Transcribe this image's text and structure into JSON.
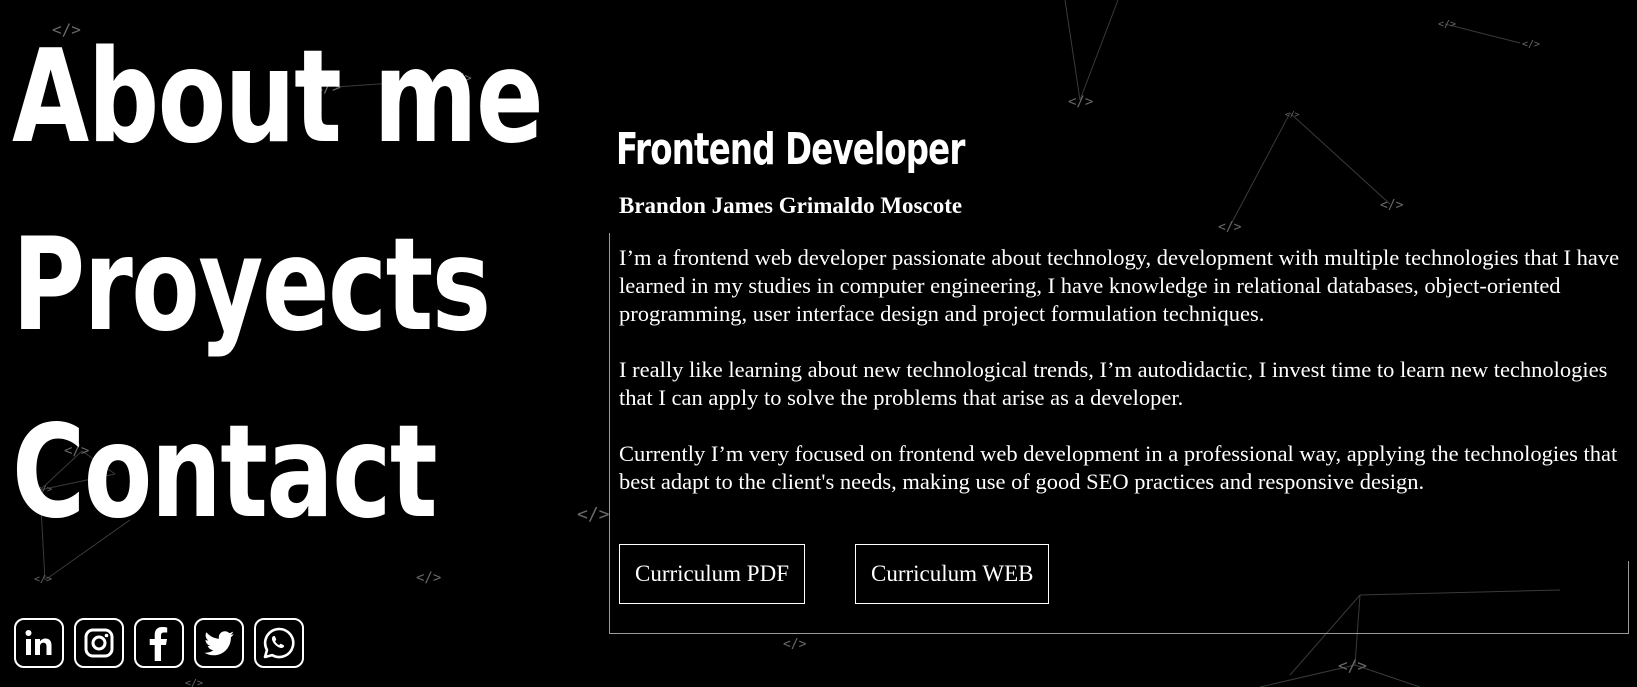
{
  "nav": {
    "about_label": "About me",
    "projects_label": "Proyects",
    "contact_label": "Contact"
  },
  "social": [
    {
      "icon": "linkedin-icon"
    },
    {
      "icon": "instagram-icon"
    },
    {
      "icon": "facebook-icon"
    },
    {
      "icon": "twitter-icon"
    },
    {
      "icon": "whatsapp-icon"
    }
  ],
  "profile": {
    "role": "Frontend Developer",
    "name": "Brandon James Grimaldo Moscote",
    "paragraphs": [
      "I’m a frontend web developer passionate about technology, development with multiple technologies that I have learned in my studies in computer engineering, I have knowledge in relational databases, object-oriented programming, user interface design and project formulation techniques.",
      "I really like learning about new technological trends, I’m autodidactic, I invest time to learn new technologies that I can apply to solve the problems that arise as a developer.",
      "Currently I’m very focused on frontend web development in a professional way, applying the technologies that best adapt to the client's needs, making use of good SEO practices and responsive design."
    ]
  },
  "buttons": {
    "cv_pdf": "Curriculum PDF",
    "cv_web": "Curriculum WEB"
  },
  "background": {
    "node_label": "</>"
  },
  "colors": {
    "background": "#000000",
    "text": "#ffffff",
    "panel_border": "#9a9a9a",
    "network": "#3a3a3a"
  }
}
